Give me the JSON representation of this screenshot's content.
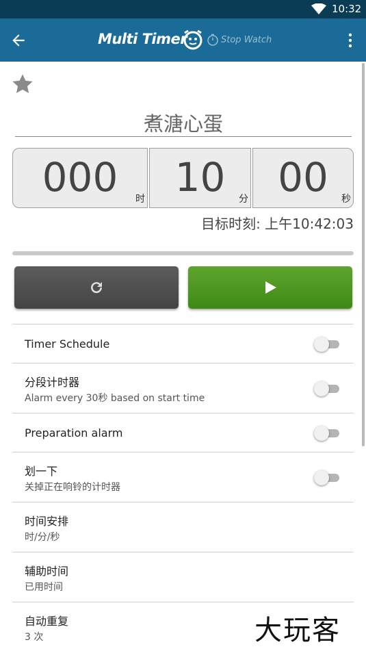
{
  "status_bar": {
    "time": "10:32",
    "icon": "wifi-icon"
  },
  "app_bar": {
    "title": "Multi Timer",
    "stopwatch_label": "Stop Watch",
    "back_icon": "arrow-left-icon",
    "menu_icon": "more-vert-icon"
  },
  "timer": {
    "name": "煮溏心蛋",
    "hours": "000",
    "hours_unit": "时",
    "minutes": "10",
    "minutes_unit": "分",
    "seconds": "00",
    "seconds_unit": "秒",
    "target_time": "目标时刻: 上午10:42:03",
    "progress": 0
  },
  "buttons": {
    "reset_icon": "refresh-icon",
    "play_icon": "play-icon"
  },
  "settings": [
    {
      "title": "Timer Schedule",
      "subtitle": "",
      "toggle": false
    },
    {
      "title": "分段计时器",
      "subtitle": "Alarm every 30秒 based on start time",
      "toggle": false
    },
    {
      "title": "Preparation alarm",
      "subtitle": "",
      "toggle": false
    },
    {
      "title": "划一下",
      "subtitle": "关掉正在响铃的计时器",
      "toggle": false
    },
    {
      "title": "时间安排",
      "subtitle": "时/分/秒"
    },
    {
      "title": "辅助时间",
      "subtitle": "已用时间"
    },
    {
      "title": "自动重复",
      "subtitle": "3 次"
    }
  ],
  "watermark": "大玩客",
  "colors": {
    "status_bar": "#0b3c56",
    "app_bar": "#1a6b97",
    "play": "#4a9622",
    "reset": "#505050"
  }
}
